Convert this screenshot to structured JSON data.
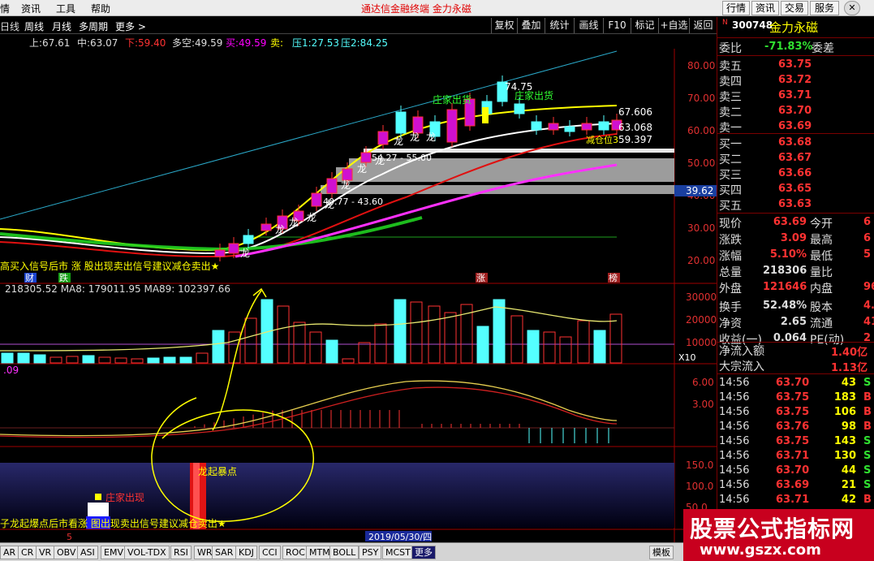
{
  "menu": {
    "items": [
      "情",
      "资讯",
      "工具",
      "帮助"
    ],
    "title": "通达信金融终端 金力永磁",
    "right_buttons": [
      "行情",
      "资讯",
      "交易",
      "服务"
    ]
  },
  "toolbar": {
    "left": [
      "日线",
      "周线",
      "月线",
      "多周期",
      "更多 >"
    ],
    "right": [
      "复权",
      "叠加",
      "统计",
      "画线",
      "F10",
      "标记",
      "+自选",
      "返回"
    ]
  },
  "indicator_line": {
    "up": "上:67.61",
    "mid": "中:63.07",
    "down": "下:59.40",
    "duo": "多空:49.59",
    "buy": "买:49.59",
    "sell": "卖:",
    "ya1": "压1:27.53",
    "ya2": "压2:84.25"
  },
  "price_axis": [
    "80.00",
    "70.00",
    "60.00",
    "50.00",
    "40.00",
    "30.00",
    "20.00"
  ],
  "labels": {
    "p6760": "67.606",
    "p6306": "63.068",
    "p5939": "59.397",
    "cur": "39.62",
    "zj1": "庄家出货",
    "zj2": "庄家出货",
    "top": "74.75",
    "r1": "54.27 - 55.00",
    "r2": "40.77 - 43.60",
    "cw": "减仓位3",
    "sig": "高买入信号后市  涨     股出现卖出信号建议减仓卖出★",
    "cai": "财",
    "die": "跌",
    "zhang": "涨",
    "bang": "榜",
    "vol": "218305.52  MA8: 179011.95  MA89: 102397.66",
    "vaxis": [
      "30000",
      "20000",
      "10000"
    ],
    "x10": "X10",
    "macd_label": ".09",
    "maxis": [
      "6.00",
      "3.00"
    ],
    "l4axis": [
      "150.0",
      "100.0",
      "50.0"
    ],
    "dragon": "龙起暴点",
    "zjcx": "庄家出现",
    "bottom_sig": "子龙起爆点后市看涨      图出现卖出信号建议减仓卖出★",
    "date": "2019/05/30/四",
    "dlabel": "龙"
  },
  "bottom_tabs": [
    "AR",
    "CR",
    "VR",
    "OBV",
    "ASI",
    "EMV",
    "VOL-TDX",
    "RSI",
    "WR",
    "SAR",
    "KDJ",
    "CCI",
    "ROC",
    "MTM",
    "BOLL",
    "PSY",
    "MCST",
    "更多"
  ],
  "bottom_right": "模板",
  "quote": {
    "code": "300748",
    "name": "金力永磁",
    "wb": "委比",
    "wb_v": "-71.83%",
    "wc": "委差",
    "sells": [
      {
        "l": "卖五",
        "p": "63.75"
      },
      {
        "l": "卖四",
        "p": "63.72"
      },
      {
        "l": "卖三",
        "p": "63.71"
      },
      {
        "l": "卖二",
        "p": "63.70"
      },
      {
        "l": "卖一",
        "p": "63.69"
      }
    ],
    "buys": [
      {
        "l": "买一",
        "p": "63.68"
      },
      {
        "l": "买二",
        "p": "63.67"
      },
      {
        "l": "买三",
        "p": "63.66"
      },
      {
        "l": "买四",
        "p": "63.65"
      },
      {
        "l": "买五",
        "p": "63.63"
      }
    ],
    "stats": [
      {
        "l1": "现价",
        "v1": "63.69",
        "l2": "今开",
        "v2": "6"
      },
      {
        "l1": "涨跌",
        "v1": "3.09",
        "l2": "最高",
        "v2": "6"
      },
      {
        "l1": "涨幅",
        "v1": "5.10%",
        "l2": "最低",
        "v2": "5"
      },
      {
        "l1": "总量",
        "v1": "218306",
        "l2": "量比",
        "v2": ""
      },
      {
        "l1": "外盘",
        "v1": "121646",
        "l2": "内盘",
        "v2": "96"
      },
      {
        "l1": "换手",
        "v1": "52.48%",
        "l2": "股本",
        "v2": "4."
      },
      {
        "l1": "净资",
        "v1": "2.65",
        "l2": "流通",
        "v2": "41"
      },
      {
        "l1": "收益(一)",
        "v1": "0.064",
        "l2": "PE(动)",
        "v2": "2"
      }
    ],
    "flow": [
      {
        "l": "净流入额",
        "v": "1.40亿"
      },
      {
        "l": "大宗流入",
        "v": "1.13亿"
      }
    ],
    "ticks": [
      {
        "t": "14:56",
        "p": "63.70",
        "q": "43",
        "s": "S"
      },
      {
        "t": "14:56",
        "p": "63.75",
        "q": "183",
        "s": "B"
      },
      {
        "t": "14:56",
        "p": "63.75",
        "q": "106",
        "s": "B"
      },
      {
        "t": "14:56",
        "p": "63.76",
        "q": "98",
        "s": "B"
      },
      {
        "t": "14:56",
        "p": "63.75",
        "q": "143",
        "s": "S"
      },
      {
        "t": "14:56",
        "p": "63.71",
        "q": "130",
        "s": "S"
      },
      {
        "t": "14:56",
        "p": "63.70",
        "q": "44",
        "s": "S"
      },
      {
        "t": "14:56",
        "p": "63.69",
        "q": "21",
        "s": "S"
      },
      {
        "t": "14:56",
        "p": "63.71",
        "q": "42",
        "s": "B"
      }
    ]
  },
  "watermark": {
    "l1": "股票公式指标网",
    "l2": "www.gszx.com"
  },
  "colors": {
    "up": "#ff3232",
    "down": "#54ffff",
    "yellow": "#ffff00",
    "magenta": "#ff00ff"
  }
}
